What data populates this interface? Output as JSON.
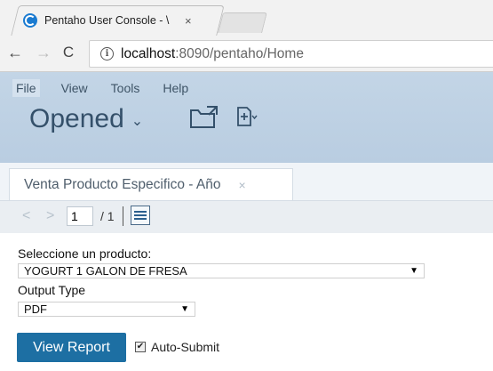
{
  "browser": {
    "tab_title": "Pentaho User Console - \\",
    "tab_close": "×",
    "url_host": "localhost",
    "url_rest": ":8090/pentaho/Home",
    "back_icon": "←",
    "forward_icon": "→",
    "reload_icon": "C",
    "info_icon": "i"
  },
  "app": {
    "menu": [
      "File",
      "View",
      "Tools",
      "Help"
    ],
    "perspective": "Opened",
    "perspective_chevron": "⌄"
  },
  "report_tab": {
    "title": "Venta Producto Especifico - Año",
    "close": "×"
  },
  "pager": {
    "prev": "<",
    "next": ">",
    "page": "1",
    "total": "/ 1"
  },
  "params": {
    "product_label": "Seleccione un producto:",
    "product_value": "YOGURT 1 GALON DE FRESA",
    "output_label": "Output Type",
    "output_value": "PDF",
    "dropdown_arrow": "▼",
    "view_button": "View Report",
    "autosubmit_label": "Auto-Submit",
    "autosubmit_checked": true,
    "check_mark": "✔"
  },
  "colors": {
    "header_bg": "#c3d5e6",
    "view_button_bg": "#1d6fa3",
    "favicon": "#1a7bd1"
  }
}
